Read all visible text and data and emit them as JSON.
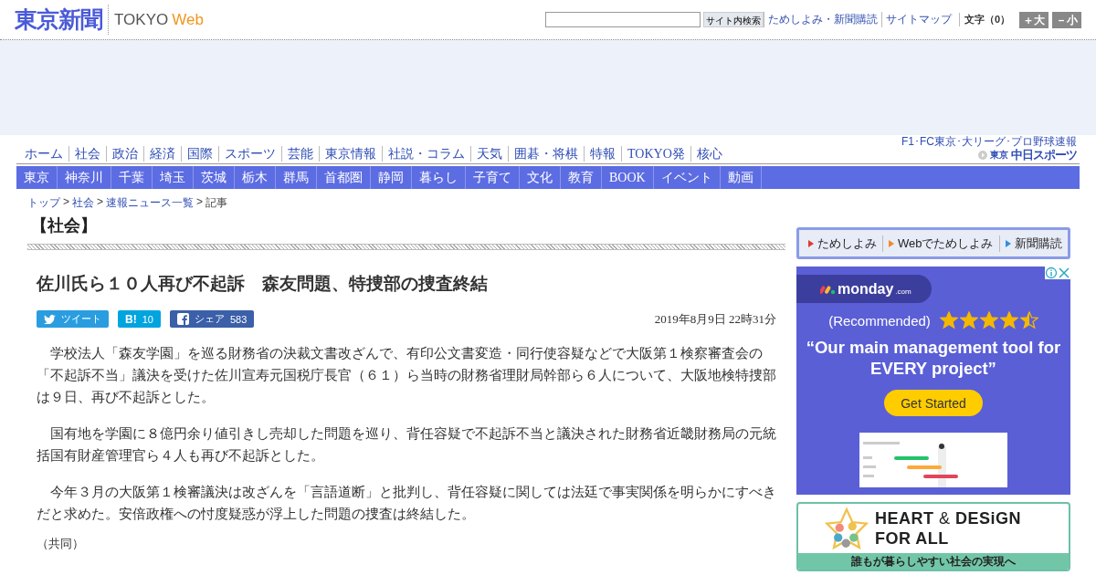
{
  "header": {
    "logo": "東京新聞",
    "logo_sub_1": "TOKYO",
    "logo_sub_2": "Web",
    "search_button": "サイト内検索",
    "links": [
      "ためしよみ・新聞購読",
      "サイトマップ"
    ],
    "font_label": "文字（0）",
    "font_buttons": [
      "＋大",
      "－小"
    ]
  },
  "nav_main": [
    "ホーム",
    "社会",
    "政治",
    "経済",
    "国際",
    "スポーツ",
    "芸能",
    "東京情報",
    "社説・コラム",
    "天気",
    "囲碁・将棋",
    "特報",
    "TOKYO発",
    "核心"
  ],
  "sports_link": {
    "top": "F1･FC東京･大リーグ･プロ野球速報",
    "brand_small": "東京",
    "brand": "中日スポーツ"
  },
  "nav_region": [
    "東京",
    "神奈川",
    "千葉",
    "埼玉",
    "茨城",
    "栃木",
    "群馬",
    "首都圏",
    "静岡",
    "暮らし",
    "子育て",
    "文化",
    "教育",
    "BOOK",
    "イベント",
    "動画"
  ],
  "breadcrumb": [
    {
      "kind": "link",
      "text": "トップ"
    },
    {
      "kind": "separator",
      "text": ">"
    },
    {
      "kind": "link",
      "text": "社会"
    },
    {
      "kind": "separator",
      "text": ">"
    },
    {
      "kind": "link",
      "text": "速報ニュース一覧"
    },
    {
      "kind": "separator",
      "text": ">"
    },
    {
      "kind": "current",
      "text": "記事"
    }
  ],
  "section_title": "【社会】",
  "article": {
    "headline": "佐川氏ら１０人再び不起訴　森友問題、特捜部の捜査終結",
    "share": [
      {
        "kind": "twitter",
        "label": "ツイート"
      },
      {
        "kind": "hatena",
        "label": "B!",
        "count": "10"
      },
      {
        "kind": "facebook",
        "label": "シェア",
        "count": "583"
      }
    ],
    "date": "2019年8月9日 22時31分",
    "paragraphs": [
      "学校法人「森友学園」を巡る財務省の決裁文書改ざんで、有印公文書変造・同行使容疑などで大阪第１検察審査会の「不起訴不当」議決を受けた佐川宣寿元国税庁長官（６１）ら当時の財務省理財局幹部ら６人について、大阪地検特捜部は９日、再び不起訴とした。",
      "国有地を学園に８億円余り値引きし売却した問題を巡り、背任容疑で不起訴不当と議決された財務省近畿財務局の元統括国有財産管理官ら４人も再び不起訴とした。",
      "今年３月の大阪第１検審議決は改ざんを「言語道断」と批判し、背任容疑に関しては法廷で事実関係を明らかにすべきだと求めた。安倍政権への忖度疑惑が浮上した問題の捜査は終結した。"
    ],
    "credit": "（共同）"
  },
  "sidebar": {
    "subscribe_links": [
      {
        "label": "ためしよみ",
        "color": "#e03a2e"
      },
      {
        "label": "Webでためしよみ",
        "color": "#f08a24"
      },
      {
        "label": "新聞購読",
        "color": "#2f8fe0"
      }
    ],
    "ad": {
      "brand": "monday",
      "brand_suffix": ".com",
      "recommended": "(Recommended)",
      "stars": 4.5,
      "quote": "“Our main management tool for EVERY project”",
      "cta": "Get Started"
    },
    "banner": {
      "title_1": "HEART",
      "title_amp": "&",
      "title_2": "DESiGN",
      "title_3": "FOR ALL",
      "caption": "誰もが暮らしやすい社会の実現へ"
    }
  }
}
